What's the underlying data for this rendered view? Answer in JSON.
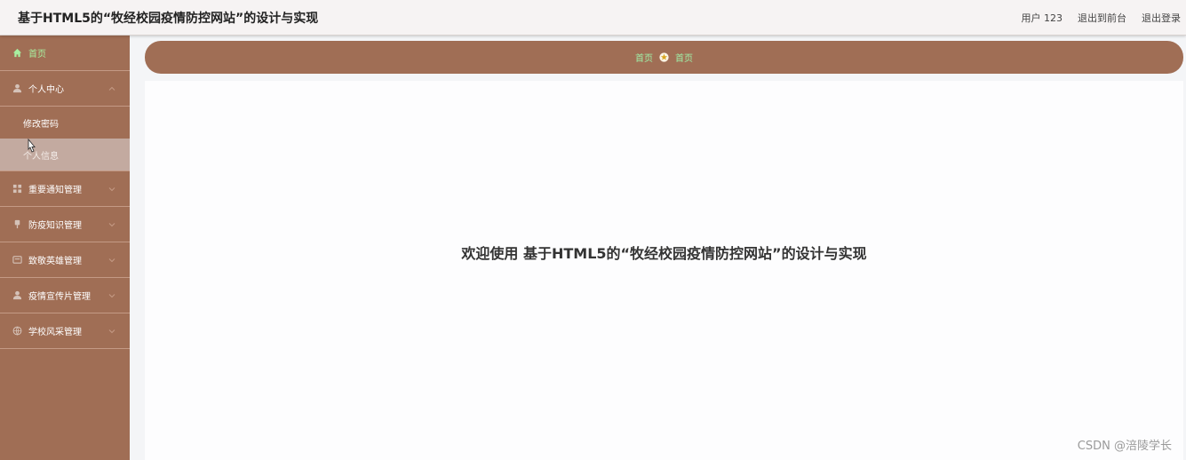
{
  "header": {
    "title": "基于HTML5的“牧经校园疫情防控网站”的设计与实现",
    "user_label": "用户 123",
    "exit_front_label": "退出到前台",
    "logout_label": "退出登录"
  },
  "sidebar": {
    "items": [
      {
        "label": "首页",
        "icon": "home-icon"
      },
      {
        "label": "个人中心",
        "icon": "user-icon",
        "children": [
          "修改密码",
          "个人信息"
        ]
      },
      {
        "label": "重要通知管理",
        "icon": "grid-icon"
      },
      {
        "label": "防疫知识管理",
        "icon": "pin-icon"
      },
      {
        "label": "致敬英雄管理",
        "icon": "card-icon"
      },
      {
        "label": "疫情宣传片管理",
        "icon": "user-icon"
      },
      {
        "label": "学校风采管理",
        "icon": "globe-icon"
      }
    ]
  },
  "breadcrumb": {
    "first": "首页",
    "second": "首页",
    "separator_icon": "star-icon"
  },
  "main": {
    "welcome": "欢迎使用 基于HTML5的“牧经校园疫情防控网站”的设计与实现"
  },
  "watermark": "CSDN @涪陵学长",
  "colors": {
    "sidebar_bg": "#a06e55",
    "active_text": "#a8f0a0",
    "hover_bg": "#c3aaa0"
  }
}
